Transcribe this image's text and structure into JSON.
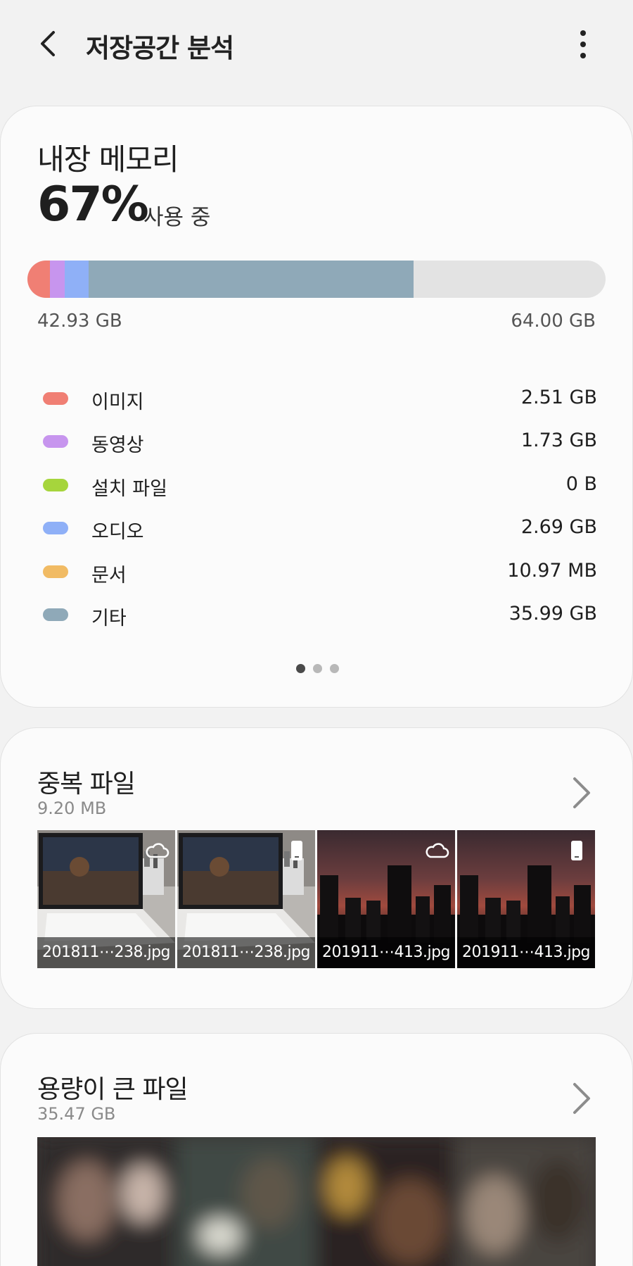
{
  "header": {
    "title": "저장공간 분석",
    "back_icon": "back-arrow-icon",
    "more_icon": "more-vertical-icon"
  },
  "storage": {
    "title": "내장 메모리",
    "percent": "67%",
    "percent_suffix": "사용 중",
    "used": "42.93 GB",
    "total": "64.00 GB",
    "usage_fraction": 0.67,
    "categories": [
      {
        "label": "이미지",
        "value": "2.51 GB",
        "color": "#f07f74"
      },
      {
        "label": "동영상",
        "value": "1.73 GB",
        "color": "#c795ee"
      },
      {
        "label": "설치 파일",
        "value": "0 B",
        "color": "#a6d53c"
      },
      {
        "label": "오디오",
        "value": "2.69 GB",
        "color": "#8fb0f7"
      },
      {
        "label": "문서",
        "value": "10.97 MB",
        "color": "#f1bb64"
      },
      {
        "label": "기타",
        "value": "35.99 GB",
        "color": "#8fa9b8"
      }
    ],
    "page_indicator": {
      "count": 3,
      "active": 0
    }
  },
  "duplicates": {
    "title": "중복 파일",
    "size": "9.20 MB",
    "files": [
      {
        "name": "201811⋯238.jpg",
        "badge": "cloud-icon"
      },
      {
        "name": "201811⋯238.jpg",
        "badge": "phone-icon"
      },
      {
        "name": "201911⋯413.jpg",
        "badge": "cloud-icon"
      },
      {
        "name": "201911⋯413.jpg",
        "badge": "phone-icon"
      }
    ]
  },
  "large_files": {
    "title": "용량이 큰 파일",
    "size": "35.47 GB"
  },
  "colors": {
    "background": "#f2f2f2",
    "card": "#fbfbfb",
    "bar_track": "#e3e3e3"
  }
}
